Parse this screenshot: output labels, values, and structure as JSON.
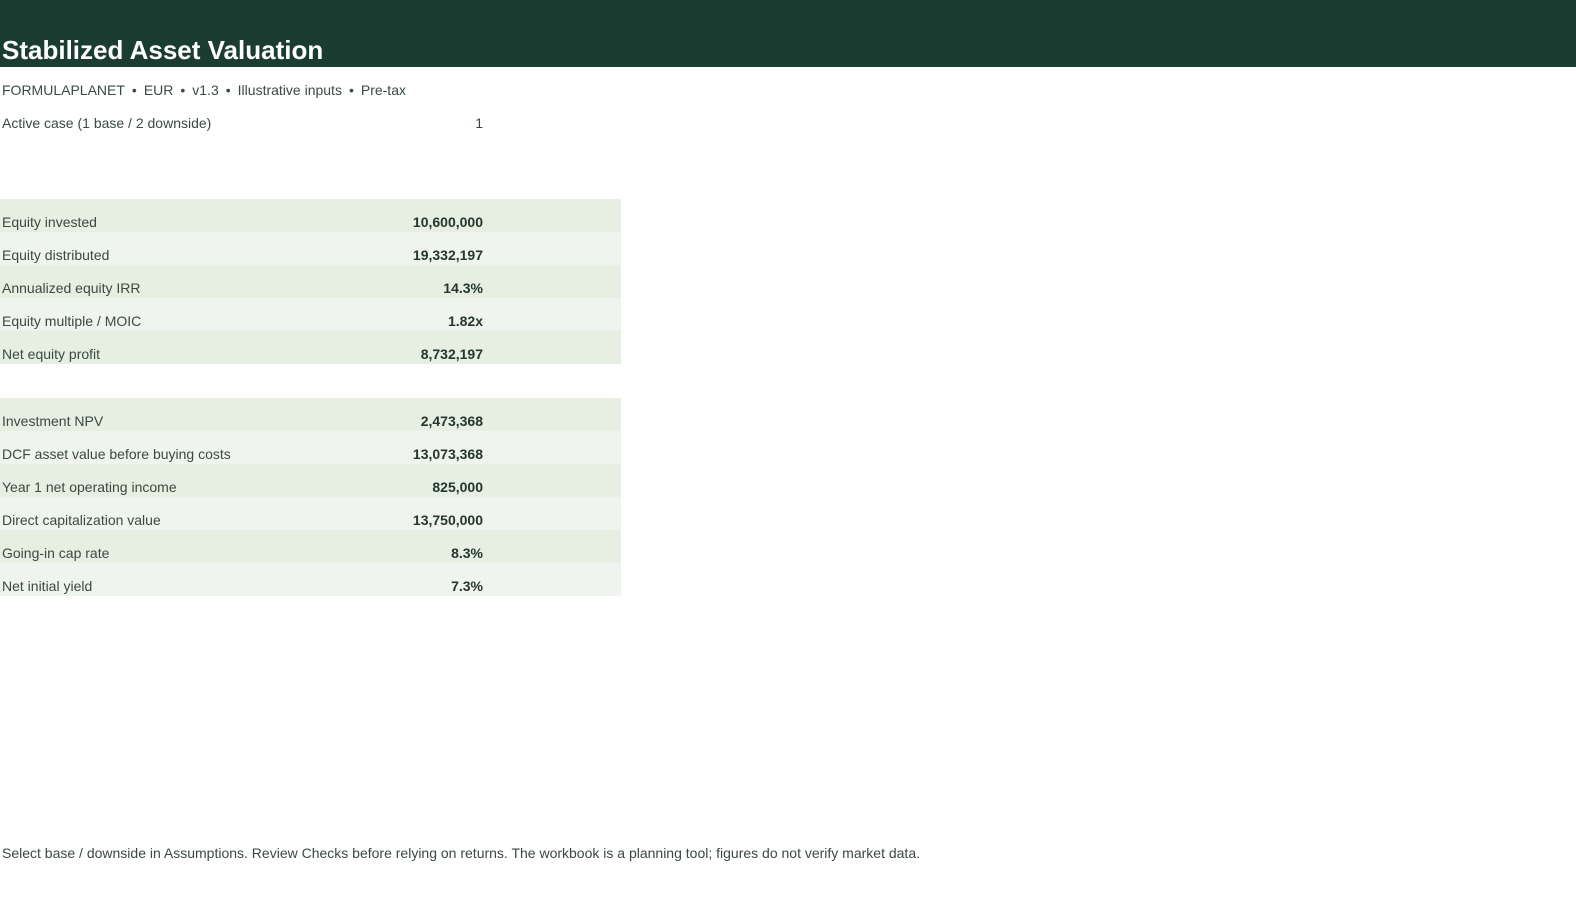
{
  "header": {
    "title": "Stabilized Asset Valuation",
    "meta": [
      "FORMULAPLANET",
      "EUR",
      "v1.3",
      "Illustrative inputs",
      "Pre-tax"
    ],
    "separator": "•"
  },
  "active_case": {
    "label": "Active case (1 base / 2 downside)",
    "value": "1"
  },
  "equity_returns": [
    {
      "label": "Equity invested",
      "value": "10,600,000"
    },
    {
      "label": "Equity distributed",
      "value": "19,332,197"
    },
    {
      "label": "Annualized equity IRR",
      "value": "14.3%"
    },
    {
      "label": "Equity multiple / MOIC",
      "value": "1.82x"
    },
    {
      "label": "Net equity profit",
      "value": "8,732,197"
    }
  ],
  "valuation": [
    {
      "label": "Investment NPV",
      "value": "2,473,368"
    },
    {
      "label": "DCF asset value before buying costs",
      "value": "13,073,368"
    },
    {
      "label": "Year 1 net operating income",
      "value": "825,000"
    },
    {
      "label": "Direct capitalization value",
      "value": "13,750,000"
    },
    {
      "label": "Going-in cap rate",
      "value": "8.3%"
    },
    {
      "label": "Net initial yield",
      "value": "7.3%"
    }
  ],
  "footer": {
    "note": "Select base / downside in Assumptions. Review Checks before relying on returns. The workbook is a planning tool; figures do not verify market data."
  },
  "colors": {
    "header_bg": "#1b3d31",
    "row_odd": "#e6efe1",
    "row_even": "#f0f4ee"
  }
}
